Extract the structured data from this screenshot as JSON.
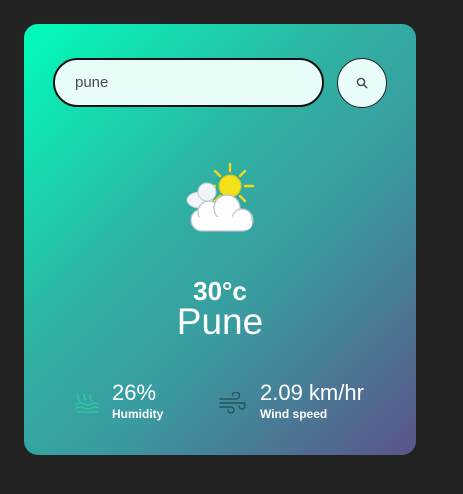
{
  "search": {
    "value": "pune",
    "placeholder": "",
    "button_icon": "search-icon"
  },
  "weather": {
    "icon": "partly-cloudy-icon",
    "temperature": "30°c",
    "city": "Pune"
  },
  "details": {
    "humidity": {
      "icon": "humidity-icon",
      "value": "26%",
      "label": "Humidity"
    },
    "wind": {
      "icon": "wind-icon",
      "value": "2.09 km/hr",
      "label": "Wind speed"
    }
  },
  "colors": {
    "page_background": "#222222",
    "card_gradient_start": "#00feba",
    "card_gradient_end": "#5b548a",
    "input_background": "#e8fcfa",
    "sun": "#f5e11a"
  }
}
